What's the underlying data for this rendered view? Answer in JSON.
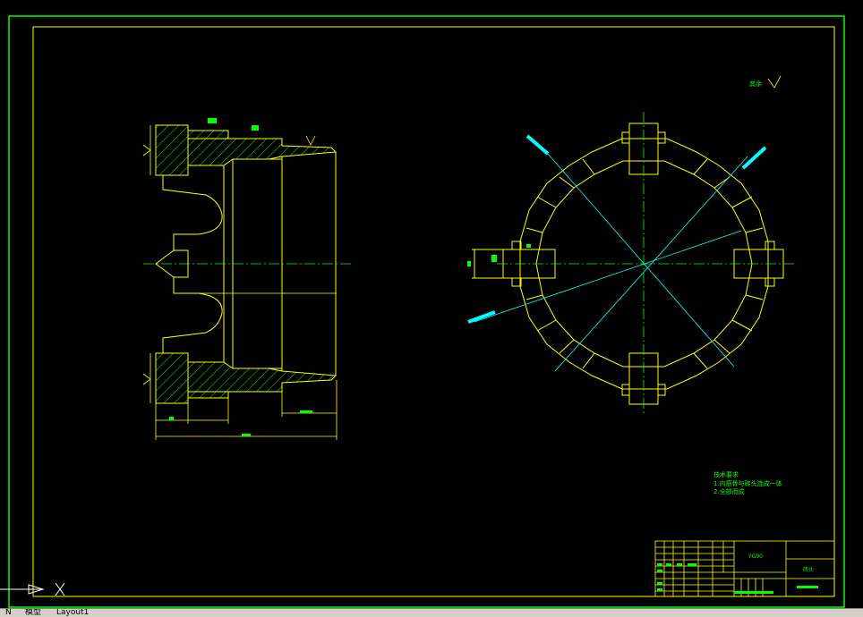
{
  "tabs": {
    "nav_label": "N",
    "model": "模型",
    "layout1": "Layout1"
  },
  "drawing": {
    "roughness_note": "其余",
    "tech_title": "技术要求",
    "tech_line1": "1.内筋骨与砖头连成一体",
    "tech_line2": "2.全部而成",
    "title_code": "YG90",
    "title_right": "砖头"
  },
  "colors": {
    "background": "#000000",
    "frame": "#ffff00",
    "frame_outer": "#00ff00",
    "hatch": "#00ff00",
    "centerline": "#00ffff",
    "text": "#00ff00",
    "geometry": "#ffff00"
  }
}
